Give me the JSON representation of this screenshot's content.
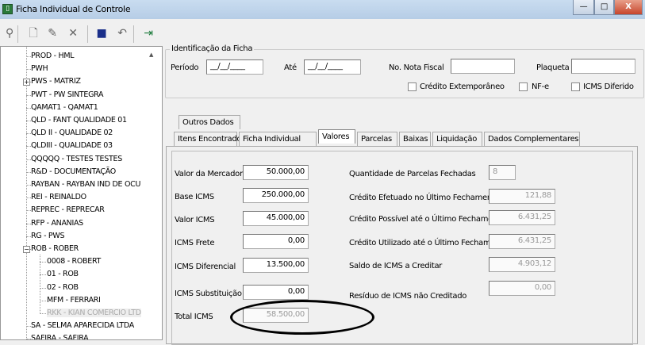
{
  "window": {
    "title": "Ficha Individual de Controle",
    "minimize": "—",
    "maximize": "□",
    "close": "X"
  },
  "toolbar": [
    {
      "icon": "binoculars-icon",
      "glyph": "⚲"
    },
    {
      "icon": "new-document-icon",
      "glyph": "🗋"
    },
    {
      "icon": "edit-icon",
      "glyph": "✎"
    },
    {
      "icon": "delete-icon",
      "glyph": "✕"
    },
    {
      "icon": "save-icon",
      "glyph": "■"
    },
    {
      "icon": "undo-icon",
      "glyph": "↶"
    },
    {
      "icon": "exit-icon",
      "glyph": "⇥"
    }
  ],
  "tree": [
    {
      "label": "PROD - HML",
      "level": 0
    },
    {
      "label": "PWH",
      "level": 0
    },
    {
      "label": "PWS - MATRIZ",
      "level": 0,
      "expander": "+"
    },
    {
      "label": "PWT - PW SINTEGRA",
      "level": 0
    },
    {
      "label": "QAMAT1 - QAMAT1",
      "level": 0
    },
    {
      "label": "QLD - FANT QUALIDADE 01",
      "level": 0
    },
    {
      "label": "QLD II - QUALIDADE 02",
      "level": 0
    },
    {
      "label": "QLDIII - QUALIDADE 03",
      "level": 0
    },
    {
      "label": "QQQQQ - TESTES TESTES",
      "level": 0
    },
    {
      "label": "R&D - DOCUMENTAÇÃO",
      "level": 0
    },
    {
      "label": "RAYBAN - RAYBAN IND DE OCU",
      "level": 0
    },
    {
      "label": "REI - REINALDO",
      "level": 0
    },
    {
      "label": "REPREC - REPRECAR",
      "level": 0
    },
    {
      "label": "RFP - ANANIAS",
      "level": 0
    },
    {
      "label": "RG - PWS",
      "level": 0
    },
    {
      "label": "ROB - ROBER",
      "level": 0,
      "expander": "−"
    },
    {
      "label": "0008 - ROBERT",
      "level": 1
    },
    {
      "label": "01 - ROB",
      "level": 1
    },
    {
      "label": "02 - ROB",
      "level": 1
    },
    {
      "label": "MFM - FERRARI",
      "level": 1
    },
    {
      "label": "RKK - KIAN COMERCIO LTD",
      "level": 1,
      "dim": true
    },
    {
      "label": "SA - SELMA APARECIDA LTDA",
      "level": 0
    },
    {
      "label": "SAFIRA - SAFIRA",
      "level": 0
    }
  ],
  "identificacao": {
    "legend": "Identificação da Ficha",
    "periodo_label": "Período",
    "periodo_value": "__/__/____",
    "ate_label": "Até",
    "ate_value": "__/__/____",
    "nota_label": "No. Nota Fiscal",
    "nota_value": "",
    "plaqueta_label": "Plaqueta",
    "plaqueta_value": "",
    "chk_credito": "Crédito Extemporâneo",
    "chk_nfe": "NF-e",
    "chk_icms": "ICMS Diferido"
  },
  "tabs_row1": [
    "Outros Dados"
  ],
  "tabs_row2": [
    "Itens Encontrados",
    "Ficha Individual",
    "Valores",
    "Parcelas",
    "Baixas",
    "Liquidação",
    "Dados Complementares"
  ],
  "valores_left": [
    {
      "label": "Valor da Mercadoria",
      "value": "50.000,00"
    },
    {
      "label": "Base ICMS",
      "value": "250.000,00"
    },
    {
      "label": "Valor ICMS",
      "value": "45.000,00"
    },
    {
      "label": "ICMS Frete",
      "value": "0,00"
    },
    {
      "label": "ICMS Diferencial",
      "value": "13.500,00"
    },
    {
      "label": "ICMS Substituição",
      "value": "0,00"
    },
    {
      "label": "Total ICMS",
      "value": "58.500,00"
    }
  ],
  "valores_right": [
    {
      "label": "Quantidade de Parcelas Fechadas",
      "value": "8"
    },
    {
      "label": "Crédito Efetuado no Último Fechamento",
      "value": "121,88"
    },
    {
      "label": "Crédito Possível até o Último Fechamento",
      "value": "6.431,25"
    },
    {
      "label": "Crédito Utilizado até o Último Fechamento",
      "value": "6.431,25"
    },
    {
      "label": "Saldo de ICMS a Creditar",
      "value": "4.903,12"
    },
    {
      "label": "Resíduo de ICMS não Creditado",
      "value": "0,00"
    }
  ]
}
